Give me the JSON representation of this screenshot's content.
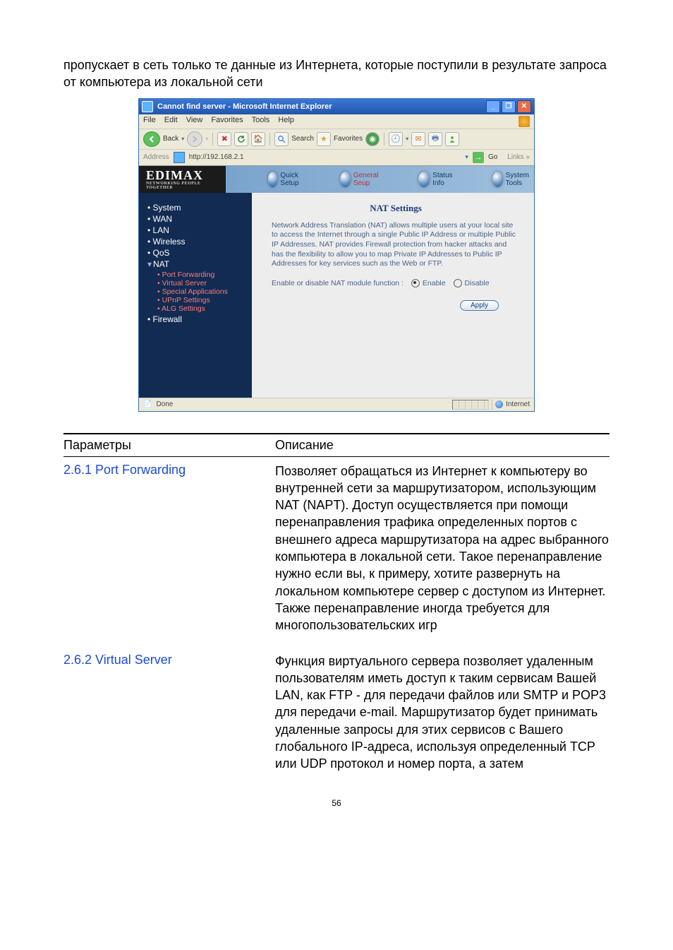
{
  "intro": "пропускает в сеть только те данные из Интернета, которые поступили в результате запроса от компьютера из локальной сети",
  "shot": {
    "window_title": "Cannot find server - Microsoft Internet Explorer",
    "menubar": [
      "File",
      "Edit",
      "View",
      "Favorites",
      "Tools",
      "Help"
    ],
    "toolbar": {
      "back": "Back",
      "search": "Search",
      "favorites": "Favorites"
    },
    "address": {
      "label": "Address",
      "url": "http://192.168.2.1",
      "go": "Go",
      "links": "Links"
    },
    "logo": "EDIMAX",
    "logo_sub": "NETWORKING PEOPLE TOGETHER",
    "orbs": {
      "quick": "Quick Setup",
      "general": "General Seup",
      "status": "Status Info",
      "tools": "System Tools"
    },
    "sidebar": {
      "system": "System",
      "wan": "WAN",
      "lan": "LAN",
      "wireless": "Wireless",
      "qos": "QoS",
      "nat": "NAT",
      "nat_sub": {
        "pf": "Port Forwarding",
        "vs": "Virtual Server",
        "sa": "Special Applications",
        "upnp": "UPnP Settings",
        "alg": "ALG Settings"
      },
      "firewall": "Firewall"
    },
    "main": {
      "heading": "NAT Settings",
      "desc": "Network Address Translation (NAT) allows multiple users at your local site to access the Internet through a single Public IP Address or multiple Public IP Addresses. NAT provides Firewall protection from hacker attacks and has the flexibility to allow you to map Private IP Addresses to Public IP Addresses for key services such as the Web or FTP.",
      "radio_label": "Enable or disable NAT module function :",
      "enable": "Enable",
      "disable": "Disable",
      "apply": "Apply"
    },
    "status": {
      "done": "Done",
      "zone": "Internet"
    }
  },
  "params": {
    "head_param": "Параметры",
    "head_desc": "Описание",
    "rows": [
      {
        "link": "2.6.1 Port Forwarding",
        "desc": "Позволяет обращаться из Интернет к компьютеру во внутренней сети за маршрутизатором, использующим NAT (NAPT). Доступ осуществляется при помощи перенаправления трафика определенных портов с внешнего адреса маршрутизатора на адрес выбранного компьютера в локальной сети. Такое перенаправление нужно если вы, к примеру, хотите развернуть на локальном компьютере сервер с доступом из Интернет. Также перенаправление иногда требуется для многопользовательских игр"
      },
      {
        "link": "2.6.2 Virtual Server",
        "desc": "Функция виртуального сервера позволяет удаленным пользователям иметь доступ к таким сервисам Вашей LAN, как FTP - для передачи файлов или SMTP и POP3 для передачи e-mail. Маршрутизатор будет принимать удаленные запросы для этих сервисов с Вашего глобального IP-адреса, используя определенный TCP или UDP протокол и номер порта, а затем"
      }
    ]
  },
  "page_number": "56"
}
